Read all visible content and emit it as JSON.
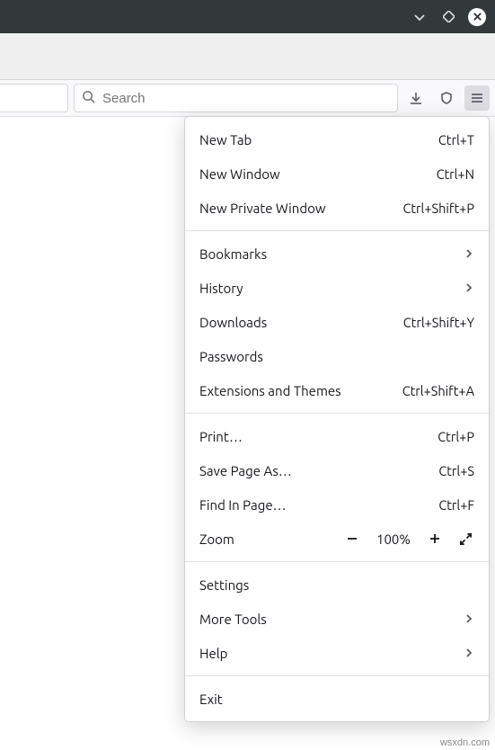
{
  "search": {
    "placeholder": "Search"
  },
  "menu": {
    "group1": [
      {
        "label": "New Tab",
        "accel": "Ctrl+T",
        "name": "menu-new-tab"
      },
      {
        "label": "New Window",
        "accel": "Ctrl+N",
        "name": "menu-new-window"
      },
      {
        "label": "New Private Window",
        "accel": "Ctrl+Shift+P",
        "name": "menu-new-private-window"
      }
    ],
    "group2": [
      {
        "label": "Bookmarks",
        "chevron": true,
        "name": "menu-bookmarks"
      },
      {
        "label": "History",
        "chevron": true,
        "name": "menu-history"
      },
      {
        "label": "Downloads",
        "accel": "Ctrl+Shift+Y",
        "name": "menu-downloads"
      },
      {
        "label": "Passwords",
        "name": "menu-passwords"
      },
      {
        "label": "Extensions and Themes",
        "accel": "Ctrl+Shift+A",
        "name": "menu-extensions"
      }
    ],
    "group3": [
      {
        "label": "Print…",
        "accel": "Ctrl+P",
        "name": "menu-print"
      },
      {
        "label": "Save Page As…",
        "accel": "Ctrl+S",
        "name": "menu-save-as"
      },
      {
        "label": "Find In Page…",
        "accel": "Ctrl+F",
        "name": "menu-find"
      }
    ],
    "zoom": {
      "label": "Zoom",
      "value": "100%"
    },
    "group4": [
      {
        "label": "Settings",
        "name": "menu-settings"
      },
      {
        "label": "More Tools",
        "chevron": true,
        "name": "menu-more-tools"
      },
      {
        "label": "Help",
        "chevron": true,
        "name": "menu-help"
      }
    ],
    "group5": [
      {
        "label": "Exit",
        "name": "menu-exit"
      }
    ]
  },
  "watermark": "wsxdn.com"
}
